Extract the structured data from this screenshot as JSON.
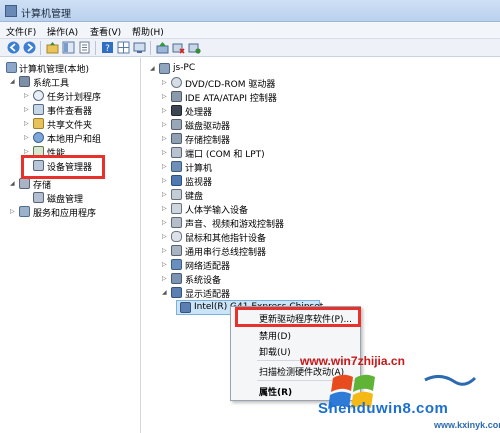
{
  "window": {
    "title": "计算机管理"
  },
  "menu": [
    "文件(F)",
    "操作(A)",
    "查看(V)",
    "帮助(H)"
  ],
  "left_tree": {
    "root": "计算机管理(本地)",
    "system_tools": "系统工具",
    "task_scheduler": "任务计划程序",
    "event_viewer": "事件查看器",
    "shared_folders": "共享文件夹",
    "local_users": "本地用户和组",
    "performance": "性能",
    "device_manager": "设备管理器",
    "storage": "存储",
    "disk_management": "磁盘管理",
    "services_apps": "服务和应用程序"
  },
  "device_tree": {
    "root": "js-PC",
    "categories": [
      "DVD/CD-ROM 驱动器",
      "IDE ATA/ATAPI 控制器",
      "处理器",
      "磁盘驱动器",
      "存储控制器",
      "端口 (COM 和 LPT)",
      "计算机",
      "监视器",
      "键盘",
      "人体学输入设备",
      "声音、视频和游戏控制器",
      "鼠标和其他指针设备",
      "通用串行总线控制器",
      "网络适配器",
      "系统设备",
      "显示适配器"
    ],
    "selected_device": "Intel(R) G41 Express Chipset"
  },
  "context_menu": {
    "update_driver": "更新驱动程序软件(P)...",
    "disable": "禁用(D)",
    "uninstall": "卸载(U)",
    "scan": "扫描检测硬件改动(A)",
    "properties": "属性(R)"
  },
  "watermarks": {
    "site1": "www.win7zhijia.cn",
    "site2": "Shenduwin8.com",
    "site3": "www.kxinyk.com"
  },
  "colors": {
    "highlight": "#e8302c",
    "selection": "#cce4f7"
  }
}
